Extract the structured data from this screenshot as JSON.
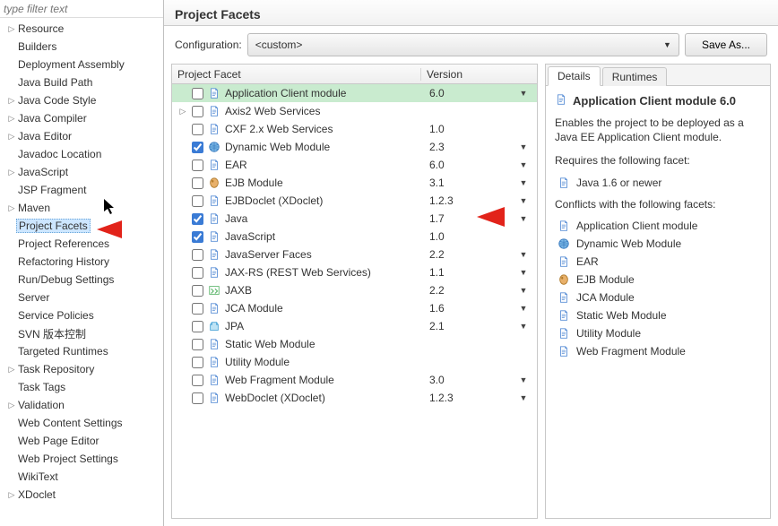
{
  "sidebar": {
    "filter_placeholder": "type filter text",
    "items": [
      {
        "label": "Resource",
        "expandable": true
      },
      {
        "label": "Builders",
        "expandable": false
      },
      {
        "label": "Deployment Assembly",
        "expandable": false
      },
      {
        "label": "Java Build Path",
        "expandable": false
      },
      {
        "label": "Java Code Style",
        "expandable": true
      },
      {
        "label": "Java Compiler",
        "expandable": true
      },
      {
        "label": "Java Editor",
        "expandable": true
      },
      {
        "label": "Javadoc Location",
        "expandable": false
      },
      {
        "label": "JavaScript",
        "expandable": true
      },
      {
        "label": "JSP Fragment",
        "expandable": false
      },
      {
        "label": "Maven",
        "expandable": true
      },
      {
        "label": "Project Facets",
        "expandable": false,
        "selected": true
      },
      {
        "label": "Project References",
        "expandable": false
      },
      {
        "label": "Refactoring History",
        "expandable": false
      },
      {
        "label": "Run/Debug Settings",
        "expandable": false
      },
      {
        "label": "Server",
        "expandable": false
      },
      {
        "label": "Service Policies",
        "expandable": false
      },
      {
        "label": "SVN 版本控制",
        "expandable": false
      },
      {
        "label": "Targeted Runtimes",
        "expandable": false
      },
      {
        "label": "Task Repository",
        "expandable": true
      },
      {
        "label": "Task Tags",
        "expandable": false
      },
      {
        "label": "Validation",
        "expandable": true
      },
      {
        "label": "Web Content Settings",
        "expandable": false
      },
      {
        "label": "Web Page Editor",
        "expandable": false
      },
      {
        "label": "Web Project Settings",
        "expandable": false
      },
      {
        "label": "WikiText",
        "expandable": false
      },
      {
        "label": "XDoclet",
        "expandable": true
      }
    ]
  },
  "main": {
    "title": "Project Facets",
    "config_label": "Configuration:",
    "config_value": "<custom>",
    "saveas_label": "Save As...",
    "columns": {
      "facet": "Project Facet",
      "version": "Version"
    },
    "rows": [
      {
        "name": "Application Client module",
        "version": "6.0",
        "dd": true,
        "dd_sel": true,
        "selected": true,
        "checked": false,
        "icon": "doc",
        "expandable": false
      },
      {
        "name": "Axis2 Web Services",
        "version": "",
        "dd": false,
        "checked": false,
        "icon": "doc",
        "expandable": true
      },
      {
        "name": "CXF 2.x Web Services",
        "version": "1.0",
        "dd": false,
        "checked": false,
        "icon": "doc",
        "expandable": false
      },
      {
        "name": "Dynamic Web Module",
        "version": "2.3",
        "dd": true,
        "checked": true,
        "icon": "globe",
        "expandable": false
      },
      {
        "name": "EAR",
        "version": "6.0",
        "dd": true,
        "checked": false,
        "icon": "doc",
        "expandable": false
      },
      {
        "name": "EJB Module",
        "version": "3.1",
        "dd": true,
        "checked": false,
        "icon": "bean",
        "expandable": false
      },
      {
        "name": "EJBDoclet (XDoclet)",
        "version": "1.2.3",
        "dd": true,
        "checked": false,
        "icon": "doc",
        "expandable": false
      },
      {
        "name": "Java",
        "version": "1.7",
        "dd": true,
        "checked": true,
        "icon": "doc",
        "expandable": false
      },
      {
        "name": "JavaScript",
        "version": "1.0",
        "dd": false,
        "checked": true,
        "icon": "doc",
        "expandable": false
      },
      {
        "name": "JavaServer Faces",
        "version": "2.2",
        "dd": true,
        "checked": false,
        "icon": "doc",
        "expandable": false
      },
      {
        "name": "JAX-RS (REST Web Services)",
        "version": "1.1",
        "dd": true,
        "checked": false,
        "icon": "doc",
        "expandable": false
      },
      {
        "name": "JAXB",
        "version": "2.2",
        "dd": true,
        "checked": false,
        "icon": "jaxb",
        "expandable": false
      },
      {
        "name": "JCA Module",
        "version": "1.6",
        "dd": true,
        "checked": false,
        "icon": "doc",
        "expandable": false
      },
      {
        "name": "JPA",
        "version": "2.1",
        "dd": true,
        "checked": false,
        "icon": "jpa",
        "expandable": false
      },
      {
        "name": "Static Web Module",
        "version": "",
        "dd": false,
        "checked": false,
        "icon": "doc",
        "expandable": false
      },
      {
        "name": "Utility Module",
        "version": "",
        "dd": false,
        "checked": false,
        "icon": "doc",
        "expandable": false
      },
      {
        "name": "Web Fragment Module",
        "version": "3.0",
        "dd": true,
        "checked": false,
        "icon": "doc",
        "expandable": false
      },
      {
        "name": "WebDoclet (XDoclet)",
        "version": "1.2.3",
        "dd": true,
        "checked": false,
        "icon": "doc",
        "expandable": false
      }
    ]
  },
  "details": {
    "tabs": [
      "Details",
      "Runtimes"
    ],
    "title": "Application Client module 6.0",
    "description": "Enables the project to be deployed as a Java EE Application Client module.",
    "requires_head": "Requires the following facet:",
    "requires": [
      {
        "name": "Java 1.6 or newer",
        "icon": "doc"
      }
    ],
    "conflicts_head": "Conflicts with the following facets:",
    "conflicts": [
      {
        "name": "Application Client module",
        "icon": "doc"
      },
      {
        "name": "Dynamic Web Module",
        "icon": "globe"
      },
      {
        "name": "EAR",
        "icon": "doc"
      },
      {
        "name": "EJB Module",
        "icon": "bean"
      },
      {
        "name": "JCA Module",
        "icon": "doc"
      },
      {
        "name": "Static Web Module",
        "icon": "doc"
      },
      {
        "name": "Utility Module",
        "icon": "doc"
      },
      {
        "name": "Web Fragment Module",
        "icon": "doc"
      }
    ]
  },
  "icons": {
    "doc": "#5a8fd6",
    "globe": "#3a8fd6",
    "bean": "#d68a3a",
    "jaxb": "#5bb56a",
    "jpa": "#4aa4d6"
  }
}
